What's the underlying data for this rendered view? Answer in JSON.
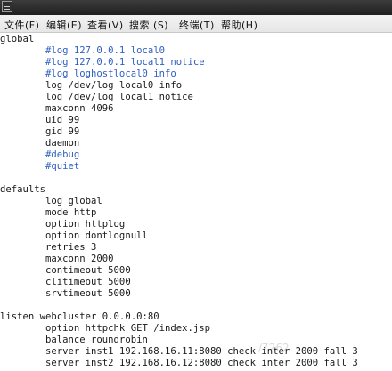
{
  "window": {
    "icon": "terminal-app-icon"
  },
  "menu": [
    {
      "label": "文件(F)"
    },
    {
      "label": "编辑(E)"
    },
    {
      "label": "查看(V)"
    },
    {
      "label": "搜索 (S)"
    },
    {
      "label": "终端(T)"
    },
    {
      "label": "帮助(H)"
    }
  ],
  "colors": {
    "comment": "#2f5fc0",
    "text": "#1a1a1a"
  },
  "lines": [
    {
      "text": "global",
      "style": "plain"
    },
    {
      "text": "        #log 127.0.0.1 local0",
      "style": "comment"
    },
    {
      "text": "        #log 127.0.0.1 local1 notice",
      "style": "comment"
    },
    {
      "text": "        #log loghostlocal0 info",
      "style": "comment"
    },
    {
      "text": "        log /dev/log local0 info",
      "style": "plain"
    },
    {
      "text": "        log /dev/log local1 notice",
      "style": "plain"
    },
    {
      "text": "        maxconn 4096",
      "style": "plain"
    },
    {
      "text": "        uid 99",
      "style": "plain"
    },
    {
      "text": "        gid 99",
      "style": "plain"
    },
    {
      "text": "        daemon",
      "style": "plain"
    },
    {
      "text": "        #debug",
      "style": "comment"
    },
    {
      "text": "        #quiet",
      "style": "comment"
    },
    {
      "text": "",
      "style": "plain"
    },
    {
      "text": "defaults",
      "style": "plain"
    },
    {
      "text": "        log global",
      "style": "plain"
    },
    {
      "text": "        mode http",
      "style": "plain"
    },
    {
      "text": "        option httplog",
      "style": "plain"
    },
    {
      "text": "        option dontlognull",
      "style": "plain"
    },
    {
      "text": "        retries 3",
      "style": "plain"
    },
    {
      "text": "        maxconn 2000",
      "style": "plain"
    },
    {
      "text": "        contimeout 5000",
      "style": "plain"
    },
    {
      "text": "        clitimeout 5000",
      "style": "plain"
    },
    {
      "text": "        srvtimeout 5000",
      "style": "plain"
    },
    {
      "text": "",
      "style": "plain"
    },
    {
      "text": "listen webcluster 0.0.0.0:80",
      "style": "plain"
    },
    {
      "text": "        option httpchk GET /index.jsp",
      "style": "plain"
    },
    {
      "text": "        balance roundrobin",
      "style": "plain"
    },
    {
      "text": "        server inst1 192.168.16.11:8080 check inter 2000 fall 3",
      "style": "plain"
    },
    {
      "text": "        server inst2 192.168.16.12:8080 check inter 2000 fall 3",
      "style": "plain"
    }
  ],
  "watermark": "/7262"
}
